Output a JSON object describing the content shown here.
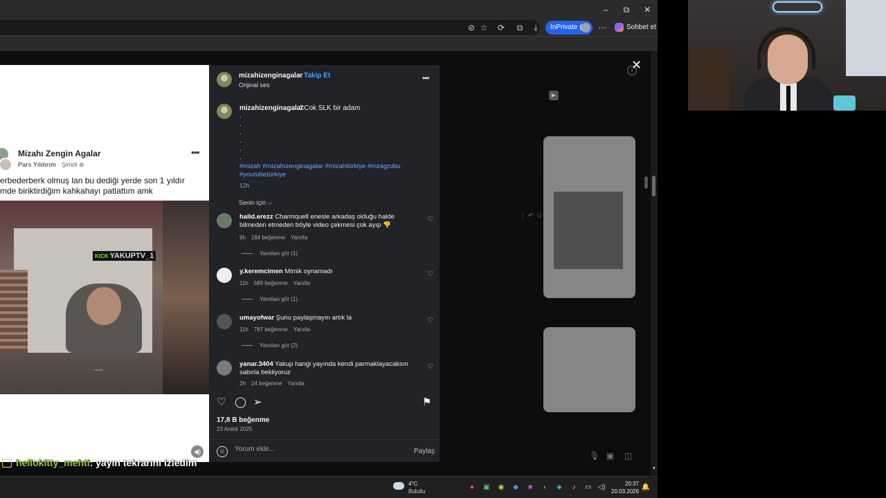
{
  "browser": {
    "inprivate_label": "InPrivate (3)",
    "chat_label": "Sohbet et",
    "window_minimize": "–",
    "window_maximize": "⧉",
    "window_close": "✕"
  },
  "video_post": {
    "author": "Mizahı Zengin Agalar",
    "sub_user": "Pars Yıldırım",
    "sub_dot": "·",
    "sub_time": "Şimdi",
    "text": "erbederberk olmuş lan bu dediği yerde son 1 yıldır\nmde biriktirdiğim kahkahayı patlattım amk",
    "stream_tag": "YAKUPTV_1",
    "stream_badge": "KICK"
  },
  "instagram": {
    "username": "mizahizenginagalar",
    "follow_label": "Takip Et",
    "dot": "•",
    "audio": "Orijinal ses",
    "caption": {
      "user": "mizahizenginagalar",
      "text": "CCok SLK bir adam",
      "dots": [
        ".",
        ".",
        ".",
        ".",
        ".",
        "."
      ],
      "tags": "#mizah #mizahızenginagalar #mizahtürkiye #mzagrubu #youtubetürkiye",
      "time": "12h"
    },
    "for_you": "Senin için ⌵",
    "comments": [
      {
        "user": "halid.erezz",
        "text": "Charmquell enesle arkadaş olduğu halde bilmeden etmeden böyle video çekmesi çok ayıp 👎",
        "time": "9h",
        "likes": "184 beğenme",
        "reply": "Yanıtla",
        "replies": "Yanıtları gör (1)"
      },
      {
        "user": "y.keremcimen",
        "text": "Mimik oynamadı",
        "time": "11h",
        "likes": "689 beğenme",
        "reply": "Yanıtla",
        "replies": "Yanıtları gör (1)"
      },
      {
        "user": "umayofwar",
        "text": "Şunu paylaşmayın artık la",
        "time": "11h",
        "likes": "787 beğenme",
        "reply": "Yanıtla",
        "replies": "Yanıtları gör (2)"
      },
      {
        "user": "yanar.3404",
        "text": "Yakup hangi yayında kendi parmaklayacaksın sabırla bekliyoruz",
        "time": "2h",
        "likes": "24 beğenme",
        "reply": "Yanıtla",
        "replies": ""
      }
    ],
    "likes": "17,8 B beğenme",
    "date": "23 Aralık 2025",
    "comment_placeholder": "Yorum ekle...",
    "share_label": "Paylaş"
  },
  "chat": {
    "user": "hellokitty_mehti",
    "message": ": yayın tekrarını izledim"
  },
  "taskbar": {
    "temp": "4°C",
    "weather": "Bulutlu",
    "time": "20:37",
    "date": "20.03.2026"
  }
}
